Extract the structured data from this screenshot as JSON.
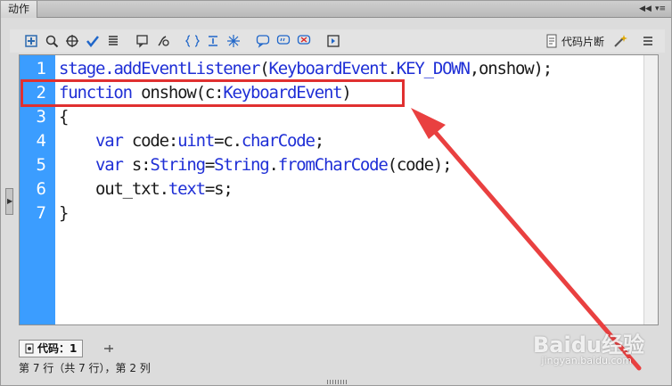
{
  "panel": {
    "tab_label": "动作"
  },
  "toolbar": {
    "buttons": [
      "add-script-item",
      "find",
      "insert-target-path",
      "check-syntax",
      "auto-format",
      "show-code-hint",
      "debug-options",
      "collapse-between-braces",
      "collapse-selection",
      "expand-all",
      "apply-block-comment",
      "apply-line-comment",
      "remove-comment",
      "show-hide-toolbox"
    ],
    "snippets_label": "代码片断"
  },
  "editor": {
    "line_numbers": [
      "1",
      "2",
      "3",
      "4",
      "5",
      "6",
      "7"
    ],
    "lines": [
      {
        "indent": "",
        "tokens": [
          {
            "t": "stage.",
            "c": "cl"
          },
          {
            "t": "addEventListener",
            "c": "fn"
          },
          {
            "t": "(",
            "c": ""
          },
          {
            "t": "KeyboardEvent",
            "c": "ty"
          },
          {
            "t": ".",
            "c": ""
          },
          {
            "t": "KEY_DOWN",
            "c": "ty"
          },
          {
            "t": ",onshow);",
            "c": ""
          }
        ]
      },
      {
        "indent": "",
        "tokens": [
          {
            "t": "function",
            "c": "kw"
          },
          {
            "t": " onshow(c:",
            "c": ""
          },
          {
            "t": "KeyboardEvent",
            "c": "ty"
          },
          {
            "t": ")",
            "c": ""
          }
        ]
      },
      {
        "indent": "",
        "tokens": [
          {
            "t": "{",
            "c": ""
          }
        ]
      },
      {
        "indent": "    ",
        "tokens": [
          {
            "t": "var",
            "c": "kw"
          },
          {
            "t": " code:",
            "c": ""
          },
          {
            "t": "uint",
            "c": "ty"
          },
          {
            "t": "=c.",
            "c": ""
          },
          {
            "t": "charCode",
            "c": "fn"
          },
          {
            "t": ";",
            "c": ""
          }
        ]
      },
      {
        "indent": "    ",
        "tokens": [
          {
            "t": "var",
            "c": "kw"
          },
          {
            "t": " s:",
            "c": ""
          },
          {
            "t": "String",
            "c": "ty"
          },
          {
            "t": "=",
            "c": ""
          },
          {
            "t": "String",
            "c": "ty"
          },
          {
            "t": ".",
            "c": ""
          },
          {
            "t": "fromCharCode",
            "c": "fn"
          },
          {
            "t": "(code);",
            "c": ""
          }
        ]
      },
      {
        "indent": "    ",
        "tokens": [
          {
            "t": "out_txt.",
            "c": ""
          },
          {
            "t": "text",
            "c": "fn"
          },
          {
            "t": "=s;",
            "c": ""
          }
        ]
      },
      {
        "indent": "",
        "tokens": [
          {
            "t": "}",
            "c": ""
          }
        ]
      }
    ]
  },
  "bottom_tab": {
    "label": "代码：1"
  },
  "status": {
    "text": "第 7 行（共 7 行），第 2 列"
  },
  "watermark": {
    "brand": "Baidu经验",
    "url": "jingyan.baidu.com"
  },
  "colors": {
    "gutter": "#3b9dff",
    "keyword": "#1f2fd6",
    "annotation": "#e03030"
  }
}
